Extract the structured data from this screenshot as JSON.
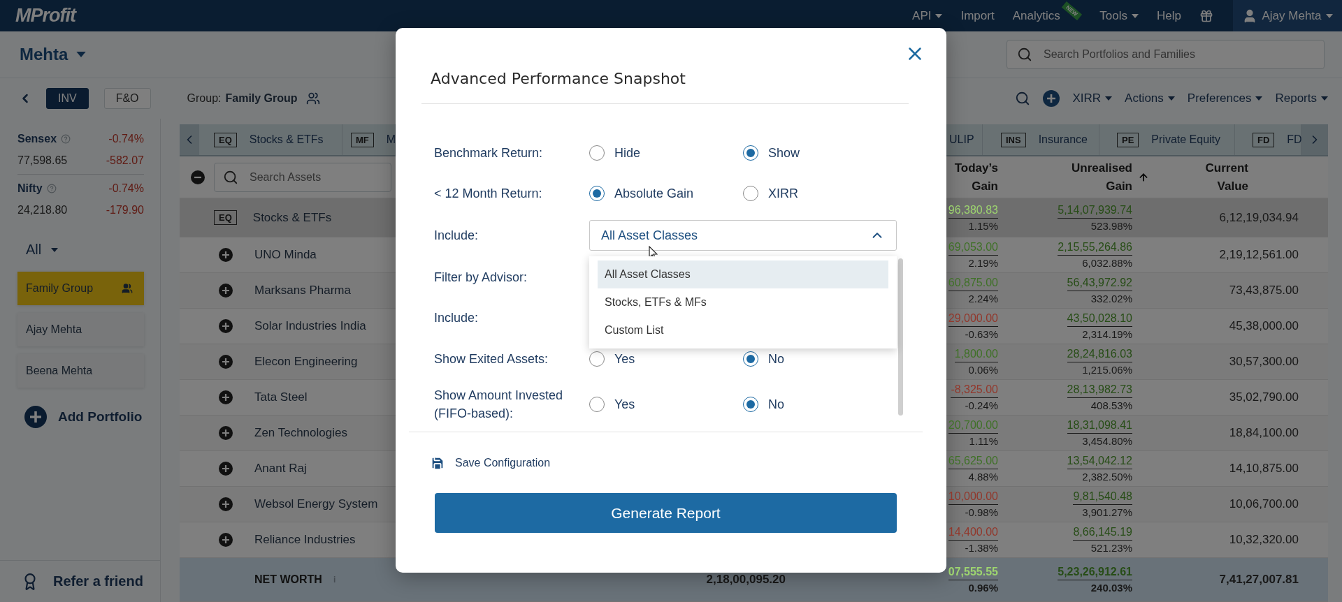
{
  "top_bar": {
    "logo": "MProfit",
    "menu": [
      {
        "label": "API",
        "dropdown": true
      },
      {
        "label": "Import",
        "dropdown": false
      },
      {
        "label": "Analytics",
        "dropdown": false,
        "badge": "NEW"
      },
      {
        "label": "Tools",
        "dropdown": true
      },
      {
        "label": "Help",
        "dropdown": false
      }
    ],
    "user": "Ajay Mehta"
  },
  "header": {
    "family": "Mehta",
    "search": {
      "placeholder": "Search Portfolios and Families"
    }
  },
  "toolbar": {
    "modes": [
      {
        "label": "INV",
        "selected": true
      },
      {
        "label": "F&O",
        "selected": false
      }
    ],
    "group_label": "Group:",
    "group_name": "Family Group",
    "menus": [
      "XIRR",
      "Actions",
      "Preferences",
      "Reports"
    ]
  },
  "sidebar": {
    "indices": [
      {
        "name": "Sensex",
        "change_pct": "-0.74%",
        "value": "77,598.65",
        "change": "-582.07"
      },
      {
        "name": "Nifty",
        "change_pct": "-0.74%",
        "value": "24,218.80",
        "change": "-179.90"
      }
    ],
    "filter": "All",
    "portfolios": [
      {
        "name": "Family Group",
        "selected": true,
        "group": true
      },
      {
        "name": "Ajay Mehta",
        "selected": false,
        "group": false
      },
      {
        "name": "Beena Mehta",
        "selected": false,
        "group": false
      }
    ],
    "add_portfolio": "Add Portfolio",
    "refer": "Refer a friend"
  },
  "table": {
    "tabs": [
      {
        "code": "EQ",
        "label": "Stocks & ETFs"
      },
      {
        "code": "MF",
        "label": "M"
      },
      {
        "label": "ULIP"
      },
      {
        "code": "INS",
        "label": "Insurance"
      },
      {
        "code": "PE",
        "label": "Private Equity"
      },
      {
        "code": "FD",
        "label": "FD"
      }
    ],
    "search": {
      "placeholder": "Search Assets"
    },
    "columns": [
      {
        "label": "Today’s Gain",
        "sorted": false
      },
      {
        "label": "Unrealised Gain",
        "sorted": true
      },
      {
        "label": "Current Value",
        "sorted": false
      }
    ],
    "group_row": {
      "code": "EQ",
      "name": "Stocks & ETFs",
      "today_gain": "96,380.83",
      "color": "#9dd46f",
      "today_pct": "1.15%",
      "unrealised_gain": "5,14,07,939.74",
      "unrealised_pct": "523.98%",
      "current_value": "6,12,19,034.94"
    },
    "rows": [
      {
        "name": "UNO Minda",
        "expanded": false,
        "today_gain": "69,053.00",
        "color": "#3f7127",
        "today_pct": "2.19%",
        "unrealised_gain": "2,15,55,264.86",
        "unrealised_pct": "6,032.88%",
        "current_value": "2,19,12,561.00"
      },
      {
        "name": "Marksans Pharma",
        "expanded": false,
        "today_gain": "60,875.00",
        "color": "#3f7127",
        "today_pct": "2.24%",
        "unrealised_gain": "56,43,972.92",
        "unrealised_pct": "332.02%",
        "current_value": "73,43,875.00"
      },
      {
        "name": "Solar Industries India",
        "expanded": false,
        "today_gain": "29,000.00",
        "color": "#92372b",
        "today_pct": "-0.63%",
        "unrealised_gain": "43,50,028.10",
        "unrealised_pct": "2,314.19%",
        "current_value": "45,38,000.00"
      },
      {
        "name": "Elecon Engineering",
        "expanded": false,
        "today_gain": "1,800.00",
        "color": "#3f7127",
        "today_pct": "0.06%",
        "unrealised_gain": "28,24,816.03",
        "unrealised_pct": "1,215.06%",
        "current_value": "30,57,300.00"
      },
      {
        "name": "Tata Steel",
        "expanded": false,
        "today_gain": "-8,325.00",
        "color": "#92372b",
        "today_pct": "-0.24%",
        "unrealised_gain": "28,13,982.73",
        "unrealised_pct": "408.53%",
        "current_value": "35,02,790.00"
      },
      {
        "name": "Zen Technologies",
        "expanded": false,
        "today_gain": "20,700.00",
        "color": "#3f7127",
        "today_pct": "1.11%",
        "unrealised_gain": "18,31,098.41",
        "unrealised_pct": "3,454.80%",
        "current_value": "18,84,100.00"
      },
      {
        "name": "Anant Raj",
        "expanded": false,
        "today_gain": "65,625.00",
        "color": "#3f7127",
        "today_pct": "4.88%",
        "unrealised_gain": "13,54,042.12",
        "unrealised_pct": "2,382.50%",
        "current_value": "14,10,875.00"
      },
      {
        "name": "Websol Energy System",
        "expanded": false,
        "today_gain": "10,000.00",
        "color": "#92372b",
        "today_pct": "-0.98%",
        "unrealised_gain": "9,81,540.48",
        "unrealised_pct": "3,901.27%",
        "current_value": "10,06,700.00"
      },
      {
        "name": "Reliance Industries",
        "expanded": false,
        "today_gain": "14,400.00",
        "color": "#92372b",
        "today_pct": "-1.38%",
        "unrealised_gain": "8,66,145.19",
        "unrealised_pct": "521.23%",
        "current_value": "10,32,320.00"
      }
    ],
    "net_worth": {
      "label": "NET WORTH",
      "info": "i",
      "invested": "2,18,00,095.20",
      "today_gain": "07,555.55",
      "color": "#9dd46f",
      "today_pct": "0.96%",
      "unrealised_gain": "5,23,26,912.61",
      "unrealised_pct": "240.03%",
      "current_value": "7,41,27,007.81"
    }
  },
  "dialog": {
    "title": "Advanced Performance Snapshot",
    "fields": [
      {
        "kind": "radio",
        "label": "Benchmark Return:",
        "options": [
          {
            "label": "Hide",
            "selected": false
          },
          {
            "label": "Show",
            "selected": true
          }
        ]
      },
      {
        "kind": "radio",
        "label": "< 12 Month Return:",
        "options": [
          {
            "label": "Absolute Gain",
            "selected": true
          },
          {
            "label": "XIRR",
            "selected": false
          }
        ]
      },
      {
        "kind": "select",
        "label": "Include:",
        "value": "All Asset Classes",
        "expanded": true,
        "options": [
          {
            "label": "All Asset Classes",
            "selected": true
          },
          {
            "label": "Stocks, ETFs & MFs",
            "selected": false
          },
          {
            "label": "Custom List",
            "selected": false
          }
        ]
      },
      {
        "kind": "covered",
        "label": "Filter by Advisor:"
      },
      {
        "kind": "covered",
        "label": "Include:"
      },
      {
        "kind": "radio",
        "label": "Show Exited Assets:",
        "options": [
          {
            "label": "Yes",
            "selected": false
          },
          {
            "label": "No",
            "selected": true
          }
        ]
      },
      {
        "kind": "radio",
        "label": "Show Amount Invested (FIFO-based):",
        "options": [
          {
            "label": "Yes",
            "selected": false
          },
          {
            "label": "No",
            "selected": true
          }
        ]
      }
    ],
    "save": "Save Configuration",
    "submit": "Generate Report"
  }
}
